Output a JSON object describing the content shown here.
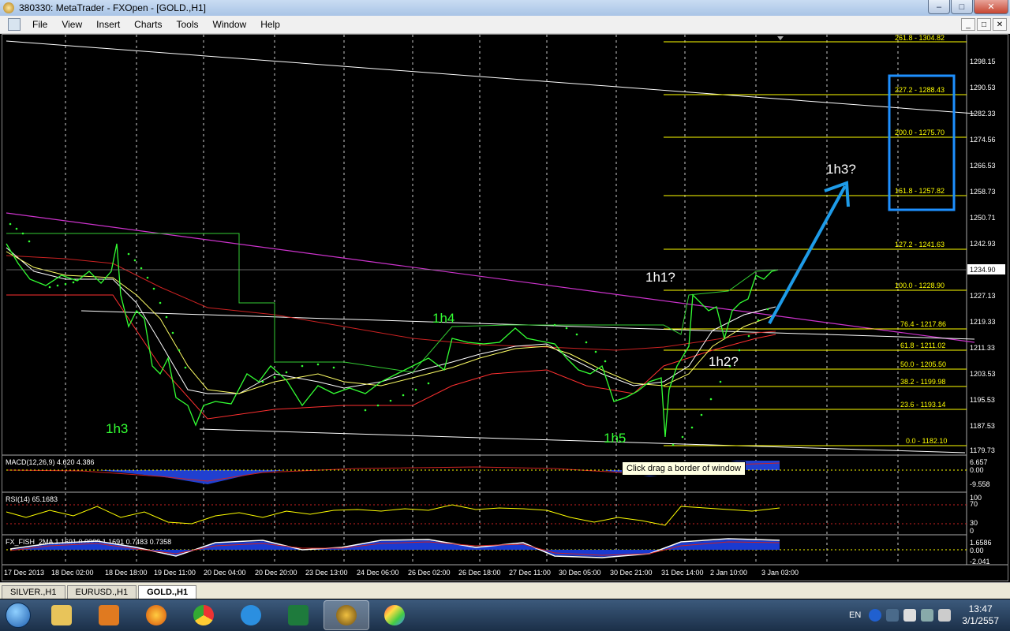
{
  "window": {
    "title": "380330: MetaTrader - FXOpen - [GOLD.,H1]",
    "min": "–",
    "max": "□",
    "close": "✕"
  },
  "menu": [
    "File",
    "View",
    "Insert",
    "Charts",
    "Tools",
    "Window",
    "Help"
  ],
  "mdi": {
    "min": "_",
    "restore": "□",
    "close": "✕"
  },
  "chart": {
    "price_labels": [
      "1298.15",
      "1290.53",
      "1282.33",
      "1274.56",
      "1266.53",
      "1258.73",
      "1250.71",
      "1242.93",
      "1234.90",
      "1227.13",
      "1219.33",
      "1211.33",
      "1203.53",
      "1195.53",
      "1187.53",
      "1179.73"
    ],
    "current_price": "1234.90",
    "fib_levels": [
      "261.8 - 1304.82",
      "227.2 - 1288.43",
      "200.0 - 1275.70",
      "161.8 - 1257.82",
      "127.2 - 1241.63",
      "100.0 - 1228.90",
      "76.4 - 1217.86",
      "61.8 - 1211.02",
      "50.0 - 1205.50",
      "38.2 - 1199.98",
      "23.6 - 1193.14",
      "0.0 - 1182.10"
    ],
    "annotations": {
      "a1h3": "1h3",
      "a1h4": "1h4",
      "a1h5": "1h5",
      "a1h1q": "1h1?",
      "a1h2q": "1h2?",
      "a1h3q": "1h3?"
    },
    "macd_label": "MACD(12,26,9) 4.620 4.386",
    "macd_scale": [
      "6.657",
      "0.00",
      "-9.558"
    ],
    "rsi_label": "RSI(14) 65.1683",
    "rsi_scale": [
      "100",
      "70",
      "30",
      "0"
    ],
    "fish_label": "FX_FISH_2MA 1.1691 0.0000 1.1691 0.7483 0.7358",
    "fish_scale": [
      "1.6586",
      "0.00",
      "-2.041"
    ],
    "time_labels": [
      "17 Dec 2013",
      "18 Dec 02:00",
      "18 Dec 18:00",
      "19 Dec 11:00",
      "20 Dec 04:00",
      "20 Dec 20:00",
      "23 Dec 13:00",
      "24 Dec 06:00",
      "26 Dec 02:00",
      "26 Dec 18:00",
      "27 Dec 11:00",
      "30 Dec 05:00",
      "30 Dec 21:00",
      "31 Dec 14:00",
      "2 Jan 10:00",
      "3 Jan 03:00"
    ],
    "tooltip": "Click  drag a border of window",
    "colors": {
      "bull": "#00ff00",
      "fib": "#ffff00",
      "box": "#1e90ff",
      "trend": "#cc33cc"
    }
  },
  "tabs": [
    "SILVER.,H1",
    "EURUSD.,H1",
    "GOLD.,H1"
  ],
  "taskbar": {
    "lang": "EN",
    "time": "13:47",
    "date": "3/1/2557"
  }
}
